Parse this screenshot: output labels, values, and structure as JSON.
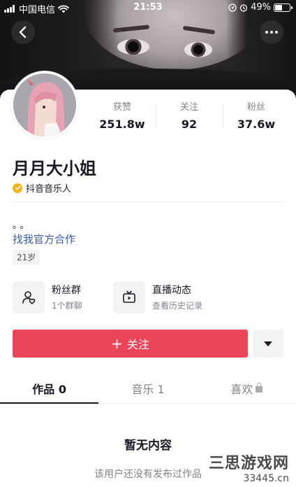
{
  "status_bar": {
    "carrier": "中国电信",
    "time": "21:53",
    "battery": "49%",
    "battery_level": 0.49,
    "icons": [
      "signal-icon",
      "wifi-icon",
      "location-icon",
      "alarm-icon",
      "battery-icon"
    ]
  },
  "nav": {
    "back_icon": "chevron-left-icon",
    "more_icon": "more-dots-icon"
  },
  "profile": {
    "name": "月月大小姐",
    "verified_label": "抖音音乐人",
    "verified_color": "#f2b51d",
    "bio": "。。",
    "link": "找我官方合作",
    "age_tag": "21岁"
  },
  "stats": [
    {
      "label": "获赞",
      "value": "251.8w"
    },
    {
      "label": "关注",
      "value": "92"
    },
    {
      "label": "粉丝",
      "value": "37.6w"
    }
  ],
  "entries": {
    "fans_group": {
      "title": "粉丝群",
      "subtitle": "1个群聊",
      "icon": "fan-group-icon"
    },
    "live": {
      "title": "直播动态",
      "subtitle": "查看历史记录",
      "icon": "tv-icon"
    }
  },
  "actions": {
    "follow_label": "关注",
    "follow_color": "#ea4558"
  },
  "tabs": [
    {
      "label": "作品 0",
      "active": true
    },
    {
      "label": "音乐 1",
      "active": false
    },
    {
      "label": "喜欢",
      "active": false,
      "locked": true
    }
  ],
  "empty_state": {
    "title": "暂无内容",
    "subtitle": "该用户还没有发布过作品"
  },
  "watermark": {
    "name": "三思游戏网",
    "domain": "33445.cn"
  }
}
